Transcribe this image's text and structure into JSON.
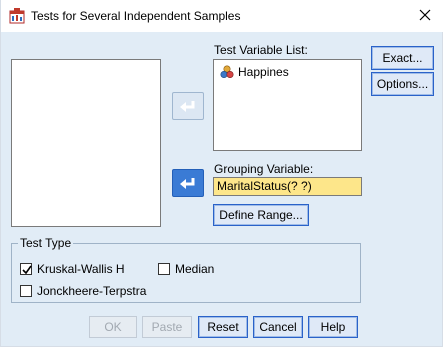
{
  "window": {
    "title": "Tests for Several Independent Samples"
  },
  "labels": {
    "test_variable_list": "Test Variable List:",
    "grouping_variable": "Grouping Variable:"
  },
  "test_variables": [
    {
      "name": "Happines",
      "icon": "scale-variable-icon"
    }
  ],
  "grouping_variable": {
    "value": "MaritalStatus(? ?)"
  },
  "buttons": {
    "exact": "Exact...",
    "options": "Options...",
    "define_range": "Define Range...",
    "ok": "OK",
    "paste": "Paste",
    "reset": "Reset",
    "cancel": "Cancel",
    "help": "Help"
  },
  "test_type": {
    "legend": "Test Type",
    "kruskal_wallis": {
      "label": "Kruskal-Wallis H",
      "checked": true
    },
    "median": {
      "label": "Median",
      "checked": false
    },
    "jonckheere": {
      "label": "Jonckheere-Terpstra",
      "checked": false
    }
  },
  "colors": {
    "dialog_bg": "#e1ecf6",
    "field_highlight": "#fde68a",
    "accent_blue": "#3a7bd5"
  }
}
